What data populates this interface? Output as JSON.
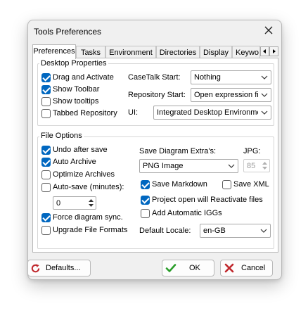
{
  "window": {
    "title": "Tools Preferences"
  },
  "tabs": [
    {
      "label": "Preferences",
      "active": true
    },
    {
      "label": "Tasks"
    },
    {
      "label": "Environment"
    },
    {
      "label": "Directories"
    },
    {
      "label": "Display"
    },
    {
      "label": "Keywo"
    }
  ],
  "tab_scroll": {
    "left_icon": "chevron-left-icon",
    "right_icon": "chevron-right-icon"
  },
  "desktop": {
    "group_label": "Desktop Properties",
    "checkboxes": [
      {
        "label": "Drag and Activate",
        "checked": true
      },
      {
        "label": "Show Toolbar",
        "checked": true
      },
      {
        "label": "Show tooltips",
        "checked": false
      },
      {
        "label": "Tabbed Repository",
        "checked": false
      }
    ],
    "casetalk_label": "CaseTalk Start:",
    "casetalk_value": "Nothing",
    "repository_label": "Repository Start:",
    "repository_value": "Open expression fil",
    "ui_label": "UI:",
    "ui_value": "Integrated Desktop Environme"
  },
  "file": {
    "group_label": "File Options",
    "checkboxes": [
      {
        "label": "Undo after save",
        "checked": true
      },
      {
        "label": "Auto Archive",
        "checked": true
      },
      {
        "label": "Optimize Archives",
        "checked": false
      },
      {
        "label": "Auto-save (minutes):",
        "checked": false
      }
    ],
    "autosave_value": "0",
    "force_sync_label": "Force diagram sync.",
    "force_sync_checked": true,
    "upgrade_label": "Upgrade File Formats",
    "upgrade_checked": false,
    "save_extras_label": "Save Diagram Extra's:",
    "save_extras_value": "PNG Image",
    "jpg_label": "JPG:",
    "jpg_value": "85",
    "save_markdown_label": "Save Markdown",
    "save_markdown_checked": true,
    "save_xml_label": "Save XML",
    "save_xml_checked": false,
    "project_open_label": "Project open will Reactivate files",
    "project_open_checked": true,
    "add_iggs_label": "Add Automatic IGGs",
    "add_iggs_checked": false,
    "locale_label": "Default Locale:",
    "locale_value": "en-GB"
  },
  "buttons": {
    "defaults": "Defaults...",
    "ok": "OK",
    "cancel": "Cancel"
  },
  "colors": {
    "accent": "#0067c0",
    "ok_check": "#2a9d2a",
    "cancel_x": "#c0282d",
    "defaults_icon": "#c0282d"
  }
}
